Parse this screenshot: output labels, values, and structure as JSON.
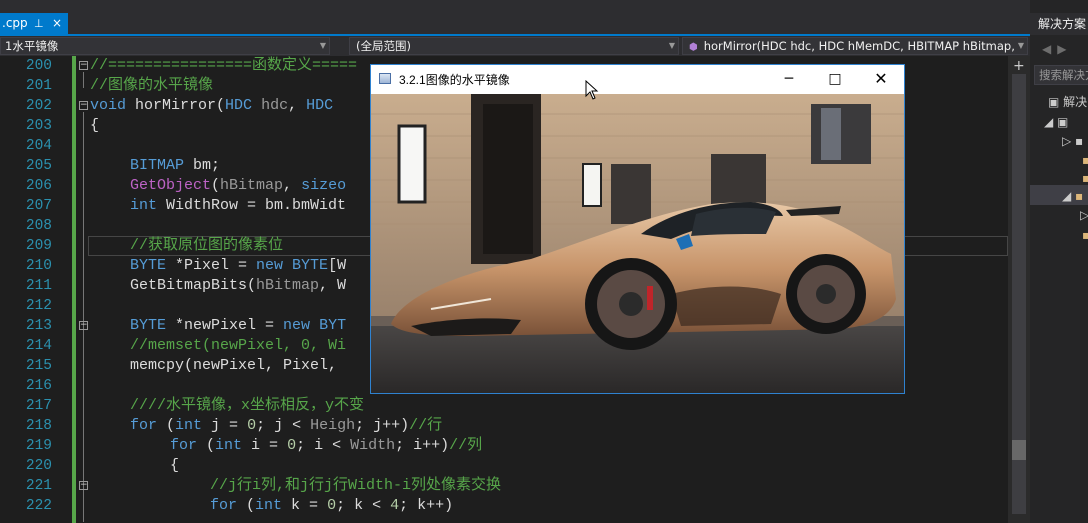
{
  "tab": {
    "filename": ".cpp",
    "pin_glyph": "⊥",
    "close_glyph": "×"
  },
  "nav": {
    "project": "1水平镜像",
    "scope": "(全局范围)",
    "member": "horMirror(HDC hdc, HDC hMemDC, HBITMAP hBitmap,"
  },
  "right_panel": {
    "title": "解决方案",
    "search_placeholder": "搜索解决方",
    "tree_top": "解决"
  },
  "line_numbers": [
    "200",
    "201",
    "202",
    "203",
    "204",
    "205",
    "206",
    "207",
    "208",
    "209",
    "210",
    "211",
    "212",
    "213",
    "214",
    "215",
    "216",
    "217",
    "218",
    "219",
    "220",
    "221",
    "222"
  ],
  "code": {
    "l200": "//================函数定义=====",
    "l201": "//图像的水平镜像",
    "l202_kw": "void",
    "l202_fn": " horMirror(",
    "l202_ty1": "HDC",
    "l202_p1": " hdc",
    "l202_sep": ", ",
    "l202_ty2": "HDC",
    "l203": "{",
    "l205_ty": "BITMAP",
    "l205_rest": " bm;",
    "l206_mac": "GetObject",
    "l206_rest1": "(",
    "l206_pm": "hBitmap",
    "l206_rest2": ", ",
    "l206_kw": "sizeo",
    "l207_kw": "int",
    "l207_rest": " WidthRow = bm.bmWidt",
    "l209": "//获取原位图的像素位",
    "l210_ty": "BYTE",
    "l210_rest": " *Pixel = ",
    "l210_kw": "new",
    "l210_ty2": " BYTE",
    "l210_rest2": "[W",
    "l211_rest": "GetBitmapBits(",
    "l211_pm": "hBitmap",
    "l211_rest2": ", W",
    "l213_ty": "BYTE",
    "l213_rest": " *newPixel = ",
    "l213_kw": "new",
    "l213_ty2": " BYT",
    "l214": "//memset(newPixel, 0, Wi",
    "l215": "memcpy(newPixel, Pixel,",
    "l217": "////水平镜像，x坐标相反，y不变",
    "l218_kw": "for",
    "l218_a": " (",
    "l218_kw2": "int",
    "l218_b": " j = ",
    "l218_n": "0",
    "l218_c": "; j < ",
    "l218_pm": "Heigh",
    "l218_d": "; j++)",
    "l218_cm": "//行",
    "l219_kw": "for",
    "l219_a": " (",
    "l219_kw2": "int",
    "l219_b": " i = ",
    "l219_n": "0",
    "l219_c": "; i < ",
    "l219_pm": "Width",
    "l219_d": "; i++)",
    "l219_cm": "//列",
    "l220": "{",
    "l221": "//j行i列,和j行j行Width-i列处像素交换",
    "l222_kw": "for",
    "l222_a": " (",
    "l222_kw2": "int",
    "l222_b": " k = ",
    "l222_n": "0",
    "l222_c": "; k < ",
    "l222_n2": "4",
    "l222_d": "; k++)"
  },
  "window": {
    "title": "3.2.1图像的水平镜像",
    "min_glyph": "─",
    "max_glyph": "□",
    "close_glyph": "✕"
  },
  "colors": {
    "accent": "#007acc",
    "keyword": "#569cd6",
    "comment": "#57a64a",
    "type": "#4ec9b0",
    "linenumber": "#2b91af"
  }
}
